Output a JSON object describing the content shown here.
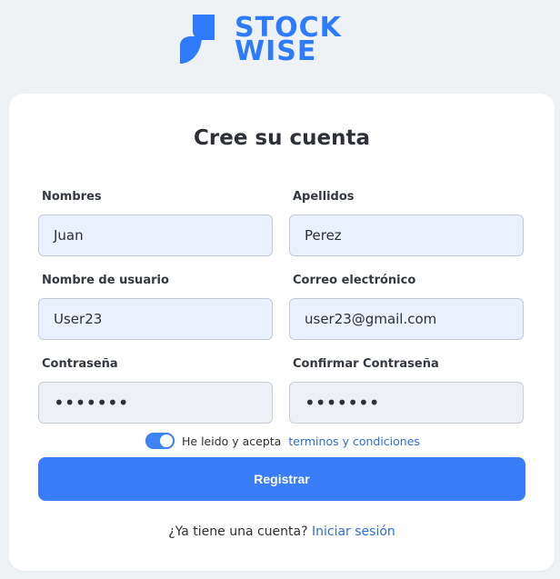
{
  "brand": {
    "name_line1": "STOCK",
    "name_line2": "WISE",
    "color": "#2f7bff",
    "icon": "stockwise-logo-icon"
  },
  "form": {
    "title": "Cree su cuenta",
    "fields": {
      "first_name": {
        "label": "Nombres",
        "value": "Juan"
      },
      "last_name": {
        "label": "Apellidos",
        "value": "Perez"
      },
      "username": {
        "label": "Nombre de usuario",
        "value": "User23"
      },
      "email": {
        "label": "Correo electrónico",
        "value": "user23@gmail.com"
      },
      "password": {
        "label": "Contraseña",
        "value": "•••••••"
      },
      "confirm_password": {
        "label": "Confirmar Contraseña",
        "value": "•••••••"
      }
    },
    "terms": {
      "checked": true,
      "label": "He leido y acepta",
      "link_text": "terminos y condiciones"
    },
    "submit_label": "Registrar",
    "footer": {
      "question": "¿Ya tiene una cuenta?",
      "link_text": "Iniciar sesión"
    }
  },
  "colors": {
    "accent": "#3a7df8",
    "link": "#2f6fd8",
    "input_bg": "#e9f0fe",
    "password_bg": "#edf1f6"
  }
}
